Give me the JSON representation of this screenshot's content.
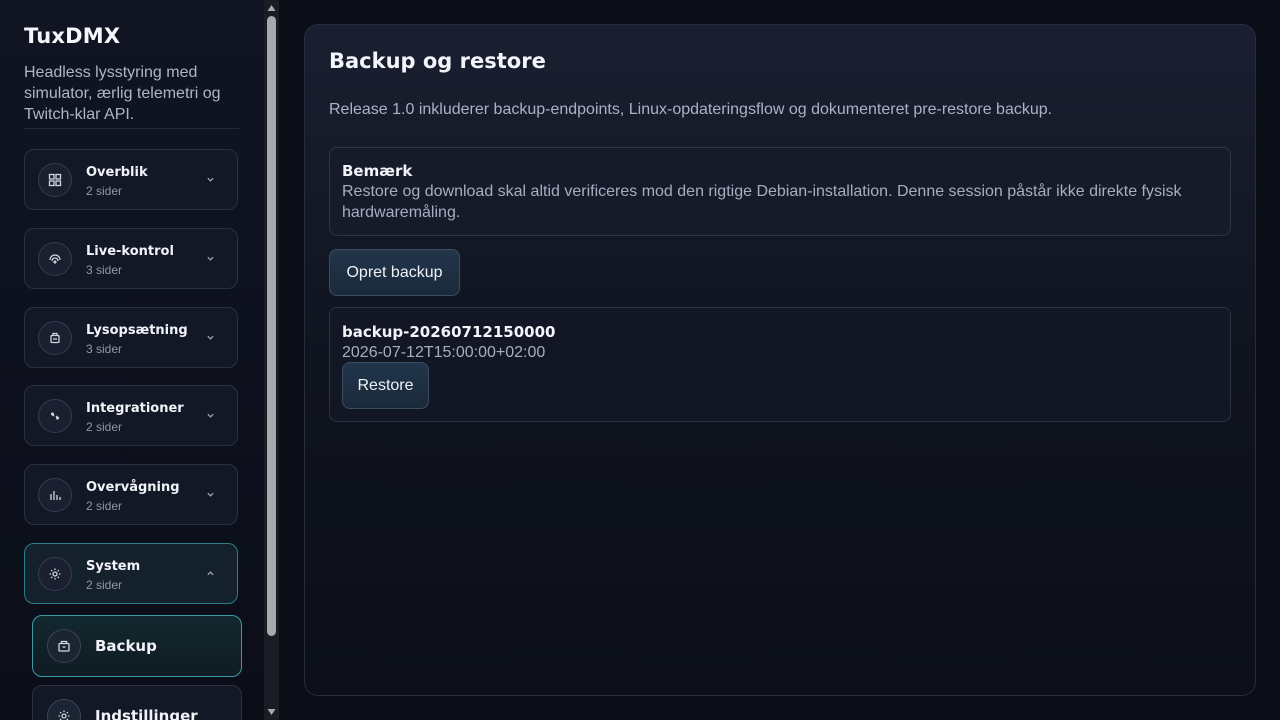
{
  "sidebar": {
    "brand": "TuxDMX",
    "tagline": "Headless lysstyring med simulator, ærlig telemetri og Twitch-klar API.",
    "groups": [
      {
        "title": "Overblik",
        "sub": "2 sider",
        "icon": "grid-icon"
      },
      {
        "title": "Live-kontrol",
        "sub": "3 sider",
        "icon": "broadcast-icon"
      },
      {
        "title": "Lysopsætning",
        "sub": "3 sider",
        "icon": "fixture-icon"
      },
      {
        "title": "Integrationer",
        "sub": "2 sider",
        "icon": "plug-icon"
      },
      {
        "title": "Overvågning",
        "sub": "2 sider",
        "icon": "bar-chart-icon"
      },
      {
        "title": "System",
        "sub": "2 sider",
        "icon": "gear-icon"
      }
    ],
    "subitems": [
      {
        "label": "Backup",
        "icon": "archive-icon"
      },
      {
        "label": "Indstillinger",
        "icon": "gear-icon"
      }
    ]
  },
  "main": {
    "title": "Backup og restore",
    "description": "Release 1.0 inkluderer backup-endpoints, Linux-opdateringsflow og dokumenteret pre-restore backup.",
    "note": {
      "title": "Bemærk",
      "text": "Restore og download skal altid verificeres mod den rigtige Debian-installation. Denne session påstår ikke direkte fysisk hardwaremåling."
    },
    "create_button": "Opret backup",
    "backups": [
      {
        "name": "backup-20260712150000",
        "date": "2026-07-12T15:00:00+02:00",
        "restore_label": "Restore"
      }
    ]
  },
  "colors": {
    "accent": "#3b9aa6",
    "background": "#0a0d15",
    "button": "#1e3044"
  }
}
